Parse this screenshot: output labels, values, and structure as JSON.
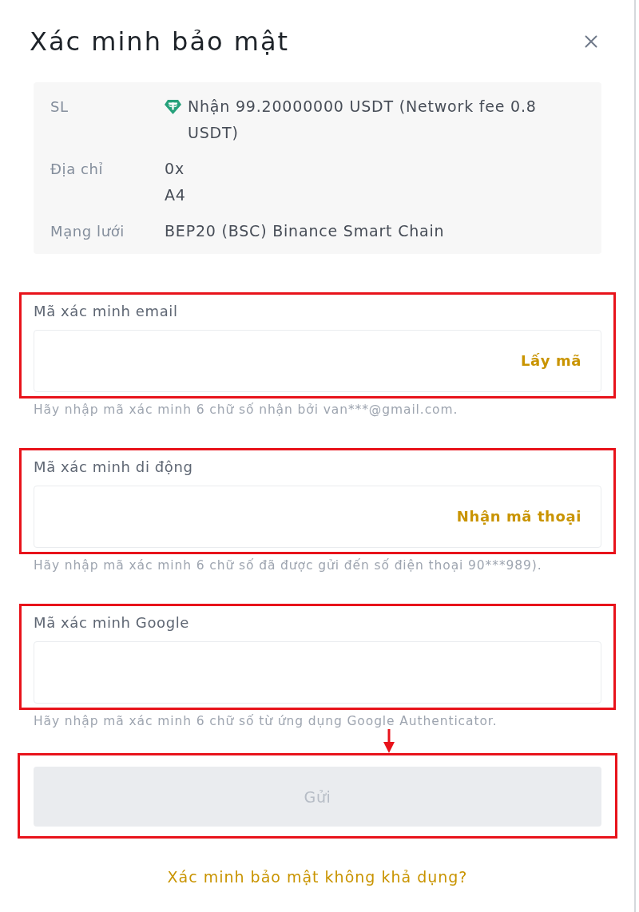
{
  "dialog": {
    "title": "Xác minh bảo mật"
  },
  "details": [
    {
      "label": "SL",
      "kind": "coin",
      "lines": [
        "Nhận 99.20000000 USDT (Network fee 0.8 USDT)"
      ]
    },
    {
      "label": "Địa chỉ",
      "kind": "plain",
      "lines": [
        "0x",
        "A4"
      ]
    },
    {
      "label": "Mạng lưới",
      "kind": "plain",
      "lines": [
        "BEP20 (BSC) Binance Smart Chain"
      ]
    }
  ],
  "fields": [
    {
      "label": "Mã xác minh email",
      "action": "Lấy mã",
      "hint": "Hãy nhập mã xác minh 6 chữ số nhận bởi van***@gmail.com.",
      "highlighted": true
    },
    {
      "label": "Mã xác minh di động",
      "action": "Nhận mã thoại",
      "hint": "Hãy nhập mã xác minh 6 chữ số đã được gửi đến số điện thoại 90***989).",
      "highlighted": true
    },
    {
      "label": "Mã xác minh Google",
      "hint": "Hãy nhập mã xác minh 6 chữ số từ ứng dụng Google Authenticator.",
      "highlighted": true
    }
  ],
  "pointer_arrow": true,
  "submit": {
    "label": "Gửi",
    "disabled": true,
    "highlighted": true
  },
  "help_link": "Xác minh bảo mật không khả dụng?"
}
